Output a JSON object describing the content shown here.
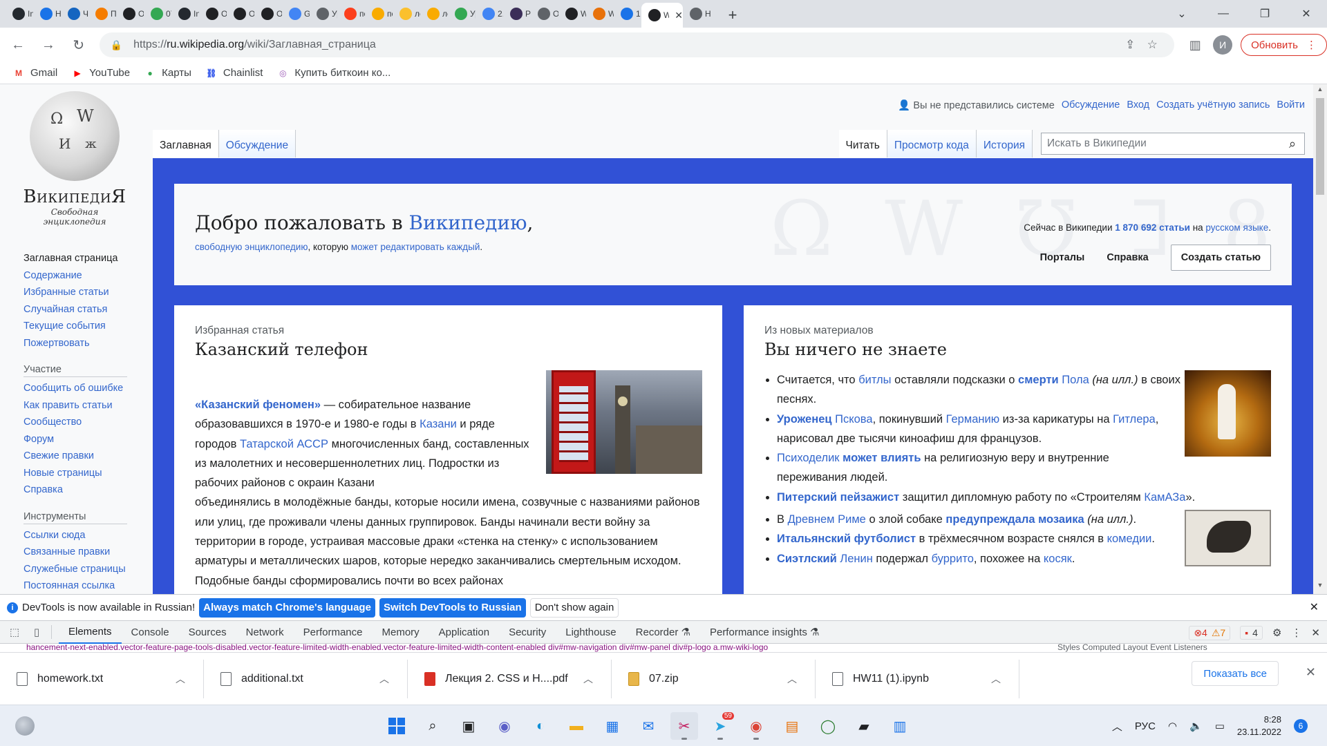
{
  "browser": {
    "tabs": [
      {
        "title": "In",
        "icon": "github-icon",
        "color": "#24292f"
      },
      {
        "title": "Ho",
        "icon": "mail-at-icon",
        "color": "#1a73e8"
      },
      {
        "title": "Че",
        "icon": "mail-icon",
        "color": "#1565c0"
      },
      {
        "title": "Пл",
        "icon": "fire-icon",
        "color": "#f57c00"
      },
      {
        "title": "О",
        "icon": "openai-icon",
        "color": "#202124"
      },
      {
        "title": "07",
        "icon": "drive-icon",
        "color": "#34a853"
      },
      {
        "title": "In",
        "icon": "github-icon",
        "color": "#24292f"
      },
      {
        "title": "О",
        "icon": "openai-icon",
        "color": "#202124"
      },
      {
        "title": "О",
        "icon": "openai-icon",
        "color": "#202124"
      },
      {
        "title": "О",
        "icon": "openai-icon",
        "color": "#202124"
      },
      {
        "title": "Gi",
        "icon": "translate-icon",
        "color": "#4285f4"
      },
      {
        "title": "Ур",
        "icon": "clock-icon",
        "color": "#5f6368"
      },
      {
        "title": "по",
        "icon": "yandex-icon",
        "color": "#fc3f1d"
      },
      {
        "title": "по",
        "icon": "image-icon",
        "color": "#f9ab00"
      },
      {
        "title": "лс",
        "icon": "play-icon",
        "color": "#fbc02d"
      },
      {
        "title": "лс",
        "icon": "image-icon",
        "color": "#f9ab00"
      },
      {
        "title": "Ур",
        "icon": "drive-icon",
        "color": "#34a853"
      },
      {
        "title": "2.",
        "icon": "docs-icon",
        "color": "#4285f4"
      },
      {
        "title": "Pl",
        "icon": "q-icon",
        "color": "#3b2e58"
      },
      {
        "title": "О",
        "icon": "globe-icon",
        "color": "#5f6368"
      },
      {
        "title": "W",
        "icon": "w-icon",
        "color": "#202124"
      },
      {
        "title": "W",
        "icon": "w-icon",
        "color": "#e8710a"
      },
      {
        "title": "1",
        "icon": "edge-icon",
        "color": "#1a73e8"
      },
      {
        "title": "W",
        "icon": "wikipedia-icon",
        "color": "#202124",
        "active": true
      },
      {
        "title": "Н",
        "icon": "chrome-icon",
        "color": "#5f6368"
      }
    ],
    "new_tab": "+",
    "url_scheme": "https://",
    "url_host": "ru.wikipedia.org",
    "url_path": "/wiki/Заглавная_страница",
    "profile_initial": "И",
    "update_label": "Обновить",
    "bookmarks": [
      {
        "label": "Gmail",
        "icon": "gmail-icon",
        "glyph": "M",
        "color": "#ea4335"
      },
      {
        "label": "YouTube",
        "icon": "youtube-icon",
        "glyph": "▶",
        "color": "#ff0000"
      },
      {
        "label": "Карты",
        "icon": "maps-pin-icon",
        "glyph": "●",
        "color": "#34a853"
      },
      {
        "label": "Chainlist",
        "icon": "chainlist-icon",
        "glyph": "⛓",
        "color": "#2f54eb"
      },
      {
        "label": "Купить биткоин ко...",
        "icon": "bitcoin-icon",
        "glyph": "◎",
        "color": "#9b59b6"
      }
    ]
  },
  "wiki": {
    "logo_name": "ВикипедиЯ",
    "logo_tagline": "Свободная энциклопедия",
    "nav_main": [
      "Заглавная страница",
      "Содержание",
      "Избранные статьи",
      "Случайная статья",
      "Текущие события",
      "Пожертвовать"
    ],
    "nav_participation_heading": "Участие",
    "nav_participation": [
      "Сообщить об ошибке",
      "Как править статьи",
      "Сообщество",
      "Форум",
      "Свежие правки",
      "Новые страницы",
      "Справка"
    ],
    "nav_tools_heading": "Инструменты",
    "nav_tools": [
      "Ссылки сюда",
      "Связанные правки",
      "Служебные страницы",
      "Постоянная ссылка"
    ],
    "personal": {
      "anon": "Вы не представились системе",
      "talk": "Обсуждение",
      "login": "Вход",
      "create": "Создать учётную запись",
      "logout": "Войти"
    },
    "tabs_left": [
      "Заглавная",
      "Обсуждение"
    ],
    "tabs_right": [
      "Читать",
      "Просмотр кода",
      "История"
    ],
    "search_placeholder": "Искать в Википедии",
    "welcome": {
      "title_pre": "Добро пожаловать в ",
      "title_link": "Википедию",
      "title_post": ",",
      "sub_link1": "свободную энциклопедию",
      "sub_mid": ", которую ",
      "sub_link2": "может редактировать каждый",
      "sub_end": ".",
      "stat_pre": "Сейчас в Википедии ",
      "stat_count": "1 870 692 статьи",
      "stat_mid": " на ",
      "stat_lang": "русском языке",
      "stat_end": ".",
      "portals": "Порталы",
      "help": "Справка",
      "create": "Создать статью",
      "watermark": "Ω W ℧ ∃ 8"
    },
    "featured": {
      "kicker": "Избранная статья",
      "title": "Казанский телефон",
      "lead_link": "«Казанский феномен»",
      "t1": " — собирательное название образовавшихся в 1970-е и 1980-е годы в ",
      "l1": "Казани",
      "t2": " и ряде городов ",
      "l2": "Татарской АССР",
      "t3": " многочисленных банд, составленных из малолетних и несовершеннолетних лиц. Подростки из рабочих районов с окраин Казани",
      "t4": "объединялись в молодёжные банды, которые носили имена, созвучные с названиями районов или улиц, где проживали члены данных группировок. Банды начинали вести войну за территории в городе, устраивая массовые драки «стенка на стенку» с использованием арматуры и металлических шаров, которые нередко заканчивались смертельным исходом. Подобные банды сформировались почти во всех районах"
    },
    "didyouknow": {
      "kicker": "Из новых материалов",
      "title": "Вы ничего не знаете",
      "items": [
        [
          [
            "t",
            "Считается, что "
          ],
          [
            "l",
            "битлы"
          ],
          [
            "t",
            " оставляли подсказки о "
          ],
          [
            "b",
            "смерти"
          ],
          [
            "l",
            " Пола"
          ],
          [
            "t",
            " "
          ],
          [
            "i",
            "(на илл.)"
          ],
          [
            "t",
            " в своих песнях."
          ]
        ],
        [
          [
            "b",
            "Уроженец"
          ],
          [
            "l",
            " Пскова"
          ],
          [
            "t",
            ", покинувший "
          ],
          [
            "l",
            "Германию"
          ],
          [
            "t",
            " из-за карикатуры на "
          ],
          [
            "l",
            "Гитлера"
          ],
          [
            "t",
            ", нарисовал две тысячи киноафиш для французов."
          ]
        ],
        [
          [
            "l",
            "Психоделик"
          ],
          [
            "t",
            " "
          ],
          [
            "b",
            "может влиять"
          ],
          [
            "t",
            " на религиозную веру и внутренние переживания людей."
          ]
        ],
        [
          [
            "b",
            "Питерский пейзажист"
          ],
          [
            "t",
            " защитил дипломную работу по «Строителям "
          ],
          [
            "l",
            "КамАЗа"
          ],
          [
            "t",
            "»."
          ]
        ],
        [
          [
            "t",
            "В "
          ],
          [
            "l",
            "Древнем Риме"
          ],
          [
            "t",
            " о злой собаке "
          ],
          [
            "b",
            "предупреждала мозаика"
          ],
          [
            "t",
            " "
          ],
          [
            "i",
            "(на илл.)"
          ],
          [
            "t",
            "."
          ]
        ],
        [
          [
            "b",
            "Итальянский футболист"
          ],
          [
            "t",
            " в трёхмесячном возрасте снялся в "
          ],
          [
            "l",
            "комедии"
          ],
          [
            "t",
            "."
          ]
        ],
        [
          [
            "b",
            "Сиэтлский"
          ],
          [
            "l",
            " Ленин"
          ],
          [
            "t",
            " подержал "
          ],
          [
            "l",
            "буррито"
          ],
          [
            "t",
            ", похожее на "
          ],
          [
            "l",
            "косяк"
          ],
          [
            "t",
            "."
          ]
        ]
      ]
    }
  },
  "devtools": {
    "info_text": "DevTools is now available in Russian!",
    "btn_match": "Always match Chrome's language",
    "btn_switch": "Switch DevTools to Russian",
    "btn_dont": "Don't show again",
    "tabs": [
      "Elements",
      "Console",
      "Sources",
      "Network",
      "Performance",
      "Memory",
      "Application",
      "Security",
      "Lighthouse",
      "Recorder ⚗",
      "Performance insights ⚗"
    ],
    "errors": "4",
    "warnings": "7",
    "issues": "4",
    "crumbs": "hancement-next-enabled.vector-feature-page-tools-disabled.vector-feature-limited-width-enabled.vector-feature-limited-width-content-enabled   div#mw-navigation   div#mw-panel   div#p-logo   a.mw-wiki-logo",
    "crumbs_right": "Styles    Computed    Layout    Event Listeners"
  },
  "downloads": {
    "items": [
      {
        "name": "homework.txt",
        "kind": "txt"
      },
      {
        "name": "additional.txt",
        "kind": "txt"
      },
      {
        "name": "Лекция 2. CSS и H....pdf",
        "kind": "pdf"
      },
      {
        "name": "07.zip",
        "kind": "zip"
      },
      {
        "name": "HW11 (1).ipynb",
        "kind": "txt"
      }
    ],
    "show_all": "Показать все"
  },
  "taskbar": {
    "language": "РУС",
    "time": "8:28",
    "date": "23.11.2022",
    "notifications": "6",
    "telegram_badge": "59"
  }
}
